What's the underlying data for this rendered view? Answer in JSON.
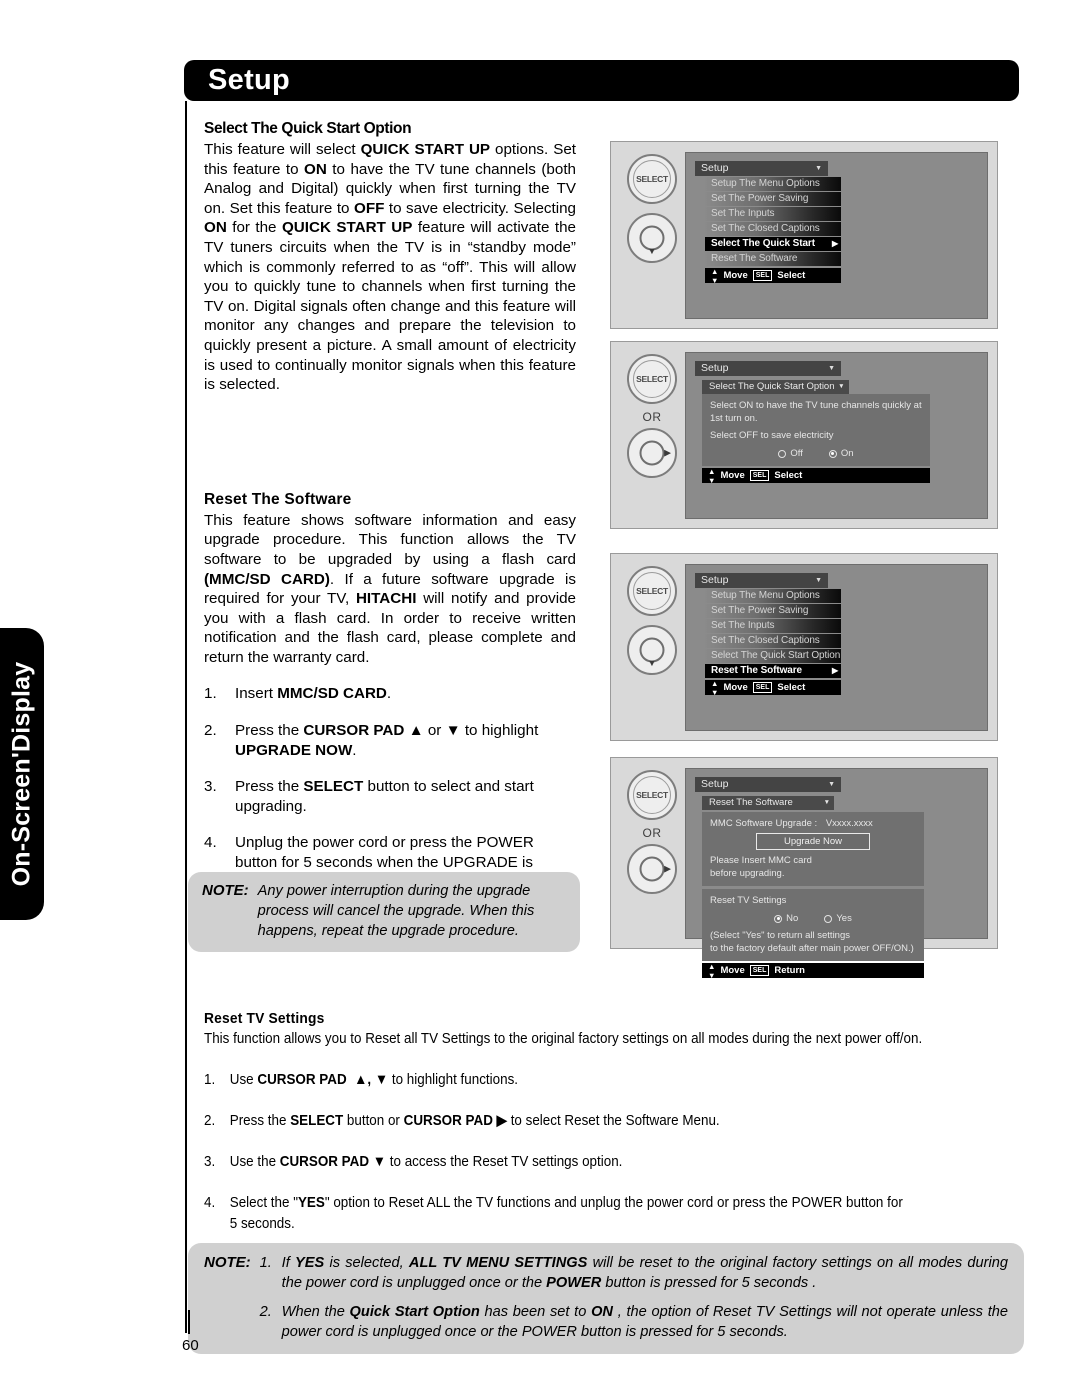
{
  "header": {
    "title": "Setup"
  },
  "sidebar": {
    "label": "On-Screen'Display"
  },
  "page": {
    "number": "60"
  },
  "sections": {
    "quick_start": {
      "heading": "Select The Quick Start Option",
      "paragraph": "This feature will select QUICK START UP options. Set this feature to ON to have the TV tune channels (both Analog and Digital) quickly when first turning the TV on. Set this feature to OFF to save electricity. Selecting ON for the QUICK START UP feature will activate the TV tuners circuits when the TV is in “standby mode” which is commonly referred to as “off”. This will allow you to quickly tune to channels when first turning the TV on. Digital signals often change and this feature will monitor any changes and prepare the television to quickly present a picture. A small amount of electricity is used to continually monitor signals when this feature is selected."
    },
    "reset_software": {
      "heading": "Reset The Software",
      "paragraph": "This feature shows software information and easy upgrade procedure. This function allows the TV software to be upgraded by using a flash card (MMC/SD CARD). If a future software upgrade is required for your TV, HITACHI will notify and provide you with a flash card. In order to receive written notification and the flash card, please complete and return the warranty card.",
      "steps": [
        {
          "num": "1.",
          "text": "Insert MMC/SD CARD."
        },
        {
          "num": "2.",
          "text": "Press the CURSOR PAD ▲ or ▼ to highlight UPGRADE NOW."
        },
        {
          "num": "3.",
          "text": "Press the SELECT button to select and start upgrading."
        },
        {
          "num": "4.",
          "text": "Unplug the power cord or press the POWER button for 5 seconds when the UPGRADE is complete."
        }
      ]
    },
    "reset_tv_settings": {
      "heading": "Reset TV Settings",
      "paragraph": "This function allows you to Reset all TV Settings to the original factory settings on all modes during the next power off/on.",
      "steps": [
        {
          "num": "1.",
          "text": "Use CURSOR PAD ▲, ▼ to highlight functions."
        },
        {
          "num": "2.",
          "text": "Press the SELECT button or CURSOR PAD ▶ to select Reset the Software Menu."
        },
        {
          "num": "3.",
          "text": "Use the CURSOR PAD ▼ to access the Reset TV settings option."
        },
        {
          "num": "4.",
          "text": "Select the \"YES\" option to Reset ALL the TV functions and unplug the power cord or press the POWER button for 5 seconds."
        }
      ]
    }
  },
  "notes": {
    "upgrade": {
      "label": "NOTE:",
      "text": "Any power interruption during the upgrade process will cancel the upgrade. When this happens, repeat the upgrade procedure."
    },
    "bottom": {
      "label": "NOTE:",
      "items": [
        {
          "num": "1.",
          "text": "If YES is selected, ALL TV MENU SETTINGS will be reset to the original factory settings on all modes during the power cord is unplugged once or the POWER button is pressed for 5 seconds ."
        },
        {
          "num": "2.",
          "text": "When the Quick Start Option has been set to ON , the option of Reset TV Settings will not operate unless the power cord is unplugged once or the POWER button is pressed for 5 seconds."
        }
      ]
    }
  },
  "osd_panels": [
    {
      "id": "panel1",
      "remote": {
        "select_label": "SELECT",
        "or_label": "",
        "pad_arrow": "▼"
      },
      "title": "Setup",
      "menu_items": [
        {
          "label": "Setup The Menu Options",
          "selected": false,
          "arrow": ""
        },
        {
          "label": "Set The Power Saving",
          "selected": false,
          "arrow": ""
        },
        {
          "label": "Set The Inputs",
          "selected": false,
          "arrow": ""
        },
        {
          "label": "Set The Closed Captions",
          "selected": false,
          "arrow": ""
        },
        {
          "label": "Select The Quick Start Option",
          "selected": true,
          "arrow": "▶"
        },
        {
          "label": "Reset The Software",
          "selected": false,
          "arrow": ""
        }
      ],
      "hint": {
        "move": "Move",
        "key": "SEL",
        "action": "Select"
      }
    },
    {
      "id": "panel2",
      "remote": {
        "select_label": "SELECT",
        "or_label": "OR",
        "pad_arrow": "▶"
      },
      "title": "Setup",
      "submenu": "Select The Quick Start Option",
      "body_lines": [
        "Select ON to have the TV tune channels quickly at",
        "1st turn on.",
        "Select OFF to save electricity"
      ],
      "radios": [
        {
          "label": "Off",
          "on": false
        },
        {
          "label": "On",
          "on": true
        }
      ],
      "hint": {
        "move": "Move",
        "key": "SEL",
        "action": "Select"
      }
    },
    {
      "id": "panel3",
      "remote": {
        "select_label": "SELECT",
        "or_label": "",
        "pad_arrow": "▼"
      },
      "title": "Setup",
      "menu_items": [
        {
          "label": "Setup The Menu Options",
          "selected": false,
          "arrow": ""
        },
        {
          "label": "Set The Power Saving",
          "selected": false,
          "arrow": ""
        },
        {
          "label": "Set The Inputs",
          "selected": false,
          "arrow": ""
        },
        {
          "label": "Set The Closed Captions",
          "selected": false,
          "arrow": ""
        },
        {
          "label": "Select The Quick Start Option",
          "selected": false,
          "arrow": ""
        },
        {
          "label": "Reset The Software",
          "selected": true,
          "arrow": "▶"
        }
      ],
      "hint": {
        "move": "Move",
        "key": "SEL",
        "action": "Select"
      }
    },
    {
      "id": "panel4",
      "remote": {
        "select_label": "SELECT",
        "or_label": "OR",
        "pad_arrow": "▶"
      },
      "title": "Setup",
      "submenu": "Reset The Software",
      "upgrade": {
        "row_label": "MMC Software Upgrade",
        "separator": ":",
        "version": "Vxxxx.xxxx",
        "button": "Upgrade Now",
        "note_line1": "Please Insert MMC card",
        "note_line2": "before upgrading."
      },
      "reset": {
        "title": "Reset TV Settings",
        "radios": [
          {
            "label": "No",
            "on": true
          },
          {
            "label": "Yes",
            "on": false
          }
        ],
        "note_line1": "(Select \"Yes\" to return all settings",
        "note_line2": "to the factory default after main power OFF/ON.)"
      },
      "hint": {
        "move": "Move",
        "key": "SEL",
        "action": "Return"
      }
    }
  ]
}
